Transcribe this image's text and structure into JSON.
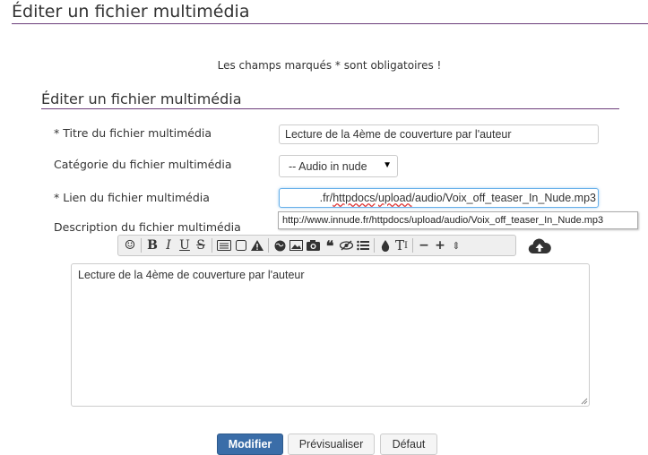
{
  "page_title": "Éditer un fichier multimédia",
  "required_note": "Les champs marqués * sont obligatoires !",
  "section_title": "Éditer un fichier multimédia",
  "form": {
    "title_label": "* Titre du fichier multimédia",
    "title_value": "Lecture de la 4ème de couverture par l'auteur",
    "category_label": "Catégorie du fichier multimédia",
    "category_value": "-- Audio in nude",
    "link_label": "* Lien du fichier multimédia",
    "link_visible_parts": [
      ".fr/",
      "httpdocs",
      "/",
      "upload",
      "/audio/Voix_off_teaser_In_Nude.mp3"
    ],
    "link_tooltip": "http://www.innude.fr/httpdocs/upload/audio/Voix_off_teaser_In_Nude.mp3",
    "description_label": "Description du fichier multimédia",
    "description_value": "Lecture de la 4ème de couverture par l'auteur"
  },
  "toolbar": {
    "bold": "B",
    "italic": "I",
    "underline": "U",
    "strike": "S",
    "font_size": "T",
    "minus": "−",
    "plus": "+",
    "stepper": "⇕"
  },
  "buttons": {
    "submit": "Modifier",
    "preview": "Prévisualiser",
    "default": "Défaut"
  },
  "colors": {
    "accent_line": "#6b3d7a",
    "primary_button": "#3a6da8"
  }
}
